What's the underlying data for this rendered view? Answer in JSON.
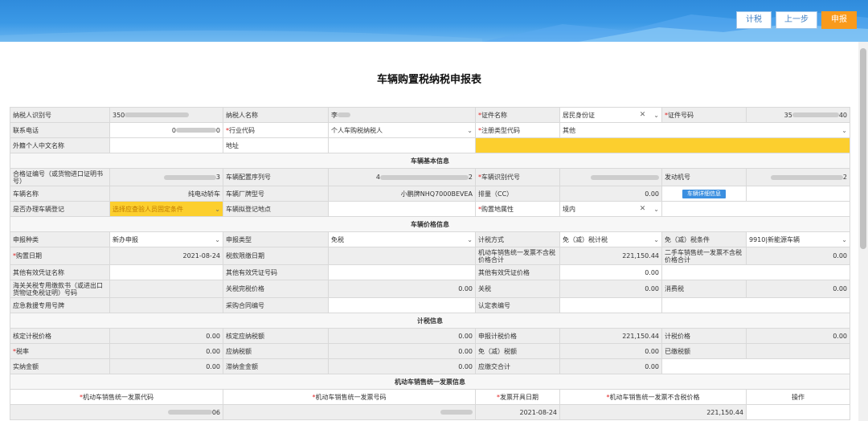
{
  "toolbar": {
    "calc_label": "计税",
    "prev_label": "上一步",
    "submit_label": "申报"
  },
  "form": {
    "title": "车辆购置税纳税申报表",
    "taxpayer": {
      "taxpayer_id_label": "纳税人识别号",
      "taxpayer_id_value": "350",
      "taxpayer_name_label": "纳税人名称",
      "taxpayer_name_value": "李",
      "cert_name_label": "证件名称",
      "cert_name_value": "居民身份证",
      "cert_no_label": "证件号码",
      "cert_no_value_start": "35",
      "cert_no_value_end": "40",
      "phone_label": "联系电话",
      "phone_value_start": "0",
      "phone_value_end": "0",
      "industry_label": "行业代码",
      "industry_value": "个人车购税纳税人",
      "reg_type_label": "注册类型代码",
      "reg_type_value": "其他",
      "foreign_name_label": "外籍个人中文名称",
      "address_label": "地址"
    },
    "vehicle": {
      "section": "车辆基本信息",
      "cert_label": "合格证编号（或货物进口证明书号）",
      "cert_value_end": "3",
      "config_label": "车辆配置序列号",
      "config_value_start": "4",
      "config_value_end": "2",
      "vin_label": "车辆识别代号",
      "engine_label": "发动机号",
      "engine_value_end": "2",
      "name_label": "车辆名称",
      "name_value": "纯电动轿车",
      "model_label": "车辆厂牌型号",
      "model_value": "小鹏牌NHQ7000BEVEA",
      "displacement_label": "排量（CC）",
      "displacement_value": "0.00",
      "detail_button": "车辆详细信息",
      "registered_label": "是否办理车辆登记",
      "registered_placeholder": "选择应查验人员固定条件",
      "reg_place_label": "车辆拟登记地点",
      "attr_label": "购置地属性",
      "attr_value": "境内"
    },
    "price": {
      "section": "车辆价格信息",
      "declare_type_label": "申报种类",
      "declare_type_value": "新办申报",
      "declare_kind_label": "申报类型",
      "declare_kind_value": "免税",
      "tax_method_label": "计税方式",
      "tax_method_value": "免（减）税计税",
      "exempt_cond_label": "免（减）税条件",
      "exempt_cond_value": "9910|新能源车辆",
      "purchase_date_label": "购置日期",
      "purchase_date_value": "2021-08-24",
      "tax_date_label": "税款限缴日期",
      "invoice_price_label": "机动车销售统一发票不含税价格合计",
      "invoice_price_value": "221,150.44",
      "used_price_label": "二手车销售统一发票不含税价格合计",
      "used_price_value": "0.00",
      "other_cert_name_label": "其他有效凭证名称",
      "other_cert_no_label": "其他有效凭证号码",
      "other_cert_price_label": "其他有效凭证价格",
      "other_cert_price_value": "0.00",
      "customs_label": "海关关税专用缴款书（或进出口货物证免税证明）号码",
      "customs_price_label": "关税完税价格",
      "customs_price_value": "0.00",
      "tariff_label": "关税",
      "tariff_value": "0.00",
      "consumption_label": "消费税",
      "consumption_value": "0.00",
      "rescue_label": "应急救援专用号牌",
      "contract_label": "采购合同编号",
      "approval_label": "认定表编号"
    },
    "tax": {
      "section": "计税信息",
      "approved_price_label": "核定计税价格",
      "approved_price_value": "0.00",
      "approved_tax_label": "核定应纳税额",
      "approved_tax_value": "0.00",
      "declared_price_label": "申报计税价格",
      "declared_price_value": "221,150.44",
      "tax_price_label": "计税价格",
      "tax_price_value": "0.00",
      "rate_label": "税率",
      "rate_value": "0.00",
      "payable_label": "应纳税额",
      "payable_value": "0.00",
      "exempt_label": "免（减）税额",
      "exempt_value": "0.00",
      "paid_label": "已缴税额",
      "actual_label": "实纳金额",
      "actual_value": "0.00",
      "late_label": "滞纳金金额",
      "late_value": "0.00",
      "due_label": "应缴交合计",
      "due_value": "0.00"
    },
    "invoice": {
      "section": "机动车销售统一发票信息",
      "headers": [
        "机动车销售统一发票代码",
        "机动车销售统一发票号码",
        "发票开具日期",
        "机动车销售统一发票不含税价格",
        "操作"
      ],
      "row": {
        "code_end": "06",
        "date": "2021-08-24",
        "price": "221,150.44"
      }
    }
  }
}
